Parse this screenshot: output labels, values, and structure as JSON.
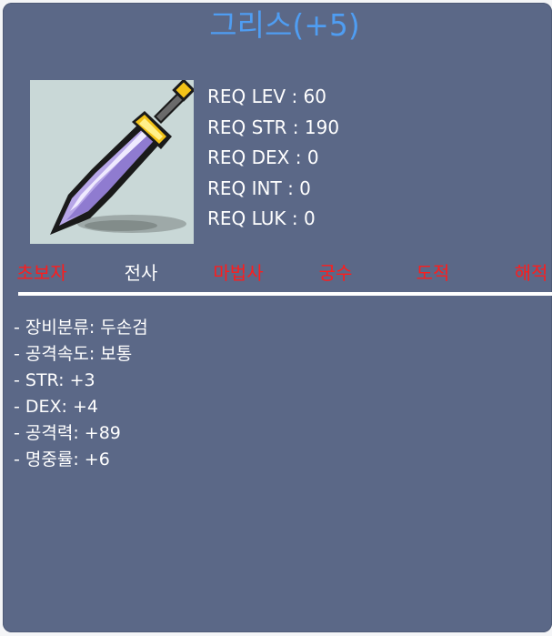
{
  "item": {
    "name": "그리스(+5)",
    "icon": "two-handed-sword-icon"
  },
  "requirements": [
    "REQ LEV : 60",
    "REQ STR : 190",
    "REQ DEX : 0",
    "REQ INT : 0",
    "REQ LUK : 0"
  ],
  "jobs": [
    {
      "label": "초보자",
      "color": "#ff1c1c"
    },
    {
      "label": "전사",
      "color": "#ffffff"
    },
    {
      "label": "마법사",
      "color": "#ff1c1c"
    },
    {
      "label": "궁수",
      "color": "#ff1c1c"
    },
    {
      "label": "도적",
      "color": "#ff1c1c"
    },
    {
      "label": "해적",
      "color": "#ff1c1c"
    }
  ],
  "stats": [
    "- 장비분류: 두손검",
    "- 공격속도: 보통",
    "- STR: +3",
    "- DEX: +4",
    "- 공격력: +89",
    "- 명중률: +6"
  ],
  "colors": {
    "panel_bg": "#5b6887",
    "title": "#4f9df2",
    "available_job": "#ffffff",
    "unavailable_job": "#ff1c1c"
  }
}
